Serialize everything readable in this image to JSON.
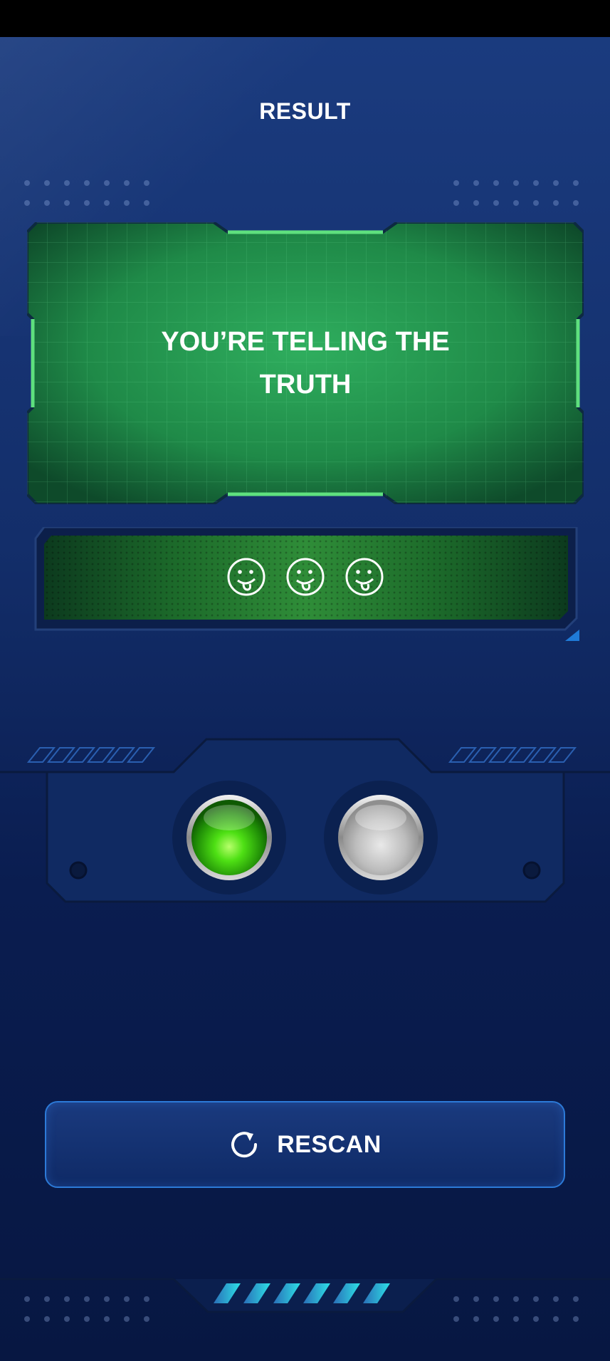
{
  "header": {
    "title": "RESULT"
  },
  "result": {
    "message": "YOU’RE TELLING THE TRUTH"
  },
  "meter": {
    "faces": [
      "tongue-face-icon",
      "tongue-face-icon",
      "tongue-face-icon"
    ]
  },
  "lights": {
    "green_state": "on",
    "white_state": "off"
  },
  "actions": {
    "rescan_label": "RESCAN"
  },
  "colors": {
    "accent_green": "#2fbf5a",
    "accent_blue": "#2c7ad8",
    "background": "#132e6a"
  }
}
